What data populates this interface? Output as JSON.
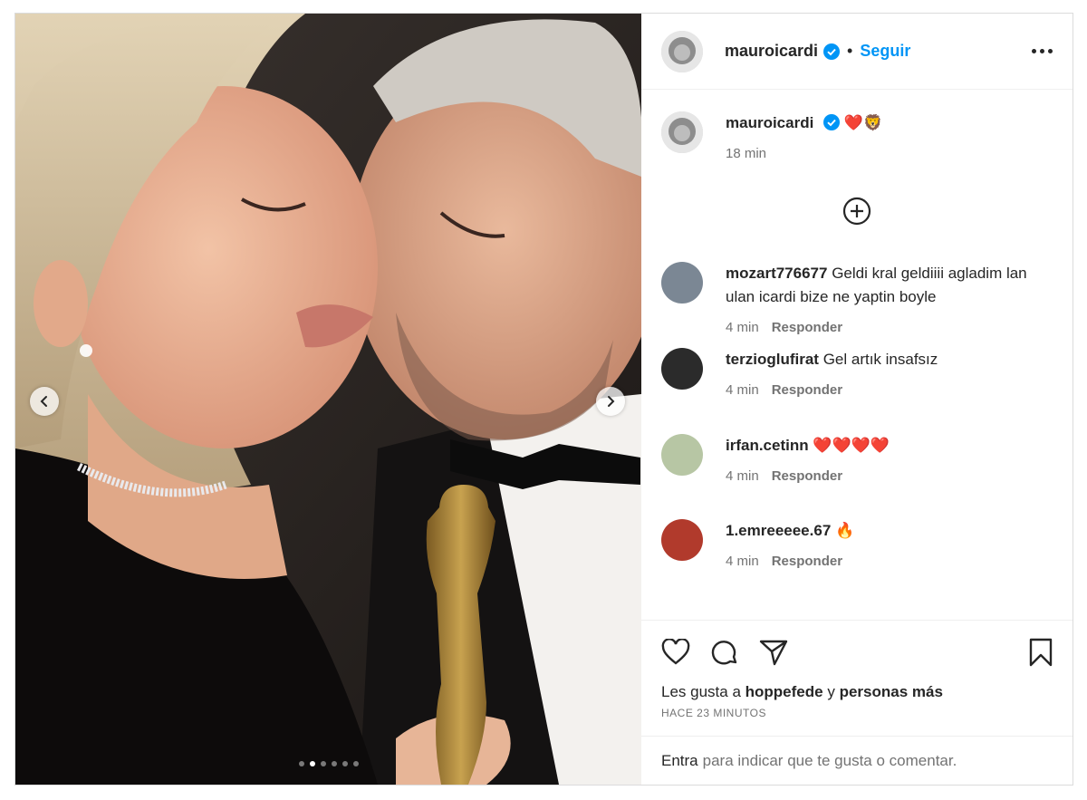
{
  "header": {
    "username": "mauroicardi",
    "separator": "•",
    "follow_label": "Seguir"
  },
  "caption": {
    "username": "mauroicardi",
    "emojis": "❤️🦁",
    "time": "18 min"
  },
  "comments": [
    {
      "username": "mozart776677",
      "text": "Geldi kral geldiiii agladim lan ulan icardi bize ne yaptin boyle",
      "time": "4 min",
      "reply": "Responder",
      "avatar_color": "#7b8794"
    },
    {
      "username": "terzioglufirat",
      "text": "Gel artık insafsız",
      "time": "4 min",
      "reply": "Responder",
      "avatar_color": "#2b2b2b"
    },
    {
      "username": "irfan.cetinn",
      "text": "❤️❤️❤️❤️",
      "time": "4 min",
      "reply": "Responder",
      "avatar_color": "#b7c6a4"
    },
    {
      "username": "1.emreeeee.67",
      "text": "🔥",
      "time": "4 min",
      "reply": "Responder",
      "avatar_color": "#b13a2c"
    }
  ],
  "likes": {
    "prefix": "Les gusta a",
    "user": "hoppefede",
    "middle": "y",
    "others": "personas más"
  },
  "timestamp": "HACE 23 MINUTOS",
  "login": {
    "link": "Entra",
    "text": "para indicar que te gusta o comentar."
  },
  "carousel": {
    "total": 6,
    "active": 2
  },
  "colors": {
    "accent": "#0095f6",
    "verified": "#0095f6",
    "heart": "#e8112d"
  },
  "icons": [
    "chevron-left-icon",
    "chevron-right-icon",
    "verified-badge-icon",
    "more-icon",
    "add-circle-icon",
    "heart-icon",
    "comment-icon",
    "share-icon",
    "bookmark-icon"
  ]
}
